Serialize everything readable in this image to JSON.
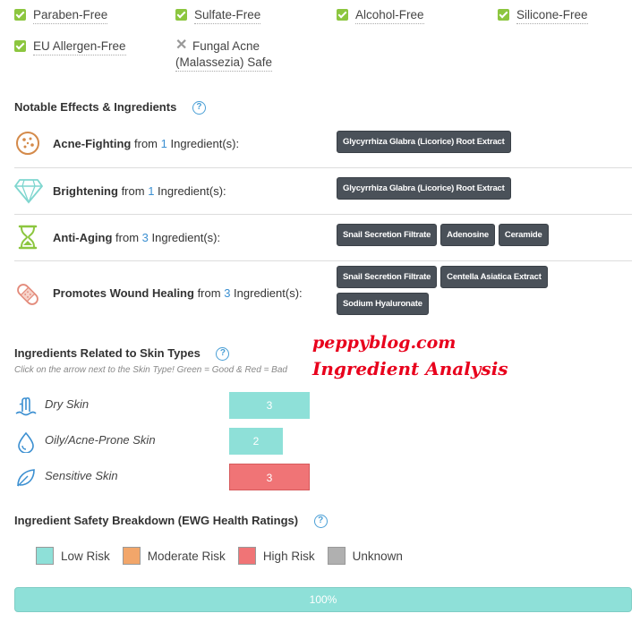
{
  "free_of": [
    {
      "label": "Paraben-Free",
      "status": "check"
    },
    {
      "label": "Sulfate-Free",
      "status": "check"
    },
    {
      "label": "Alcohol-Free",
      "status": "check"
    },
    {
      "label": "Silicone-Free",
      "status": "check"
    },
    {
      "label": "EU Allergen-Free",
      "status": "check"
    },
    {
      "label": "Fungal Acne",
      "label2": "(Malassezia) Safe",
      "status": "cross"
    }
  ],
  "notable": {
    "title": "Notable Effects & Ingredients",
    "help": "?",
    "from_text": "from",
    "suffix": "Ingredient(s):",
    "effects": [
      {
        "name": "Acne-Fighting",
        "count": "1",
        "icon": "acne-icon",
        "tags": [
          "Glycyrrhiza Glabra (Licorice) Root Extract"
        ]
      },
      {
        "name": "Brightening",
        "count": "1",
        "icon": "diamond-icon",
        "tags": [
          "Glycyrrhiza Glabra (Licorice) Root Extract"
        ]
      },
      {
        "name": "Anti-Aging",
        "count": "3",
        "icon": "hourglass-icon",
        "tags": [
          "Snail Secretion Filtrate",
          "Adenosine",
          "Ceramide"
        ]
      },
      {
        "name": "Promotes Wound Healing",
        "count": "3",
        "icon": "bandage-icon",
        "tags": [
          "Snail Secretion Filtrate",
          "Centella Asiatica Extract",
          "Sodium Hyaluronate"
        ]
      }
    ]
  },
  "skin_types": {
    "title": "Ingredients Related to Skin Types",
    "help": "?",
    "hint": "Click on the arrow next to the Skin Type! Green = Good & Red = Bad",
    "rows": [
      {
        "label": "Dry Skin",
        "value": "3",
        "icon": "dry-skin-icon",
        "color": "#8ee0d8"
      },
      {
        "label": "Oily/Acne-Prone Skin",
        "value": "2",
        "icon": "oily-skin-icon",
        "color": "#8ee0d8"
      },
      {
        "label": "Sensitive Skin",
        "value": "3",
        "icon": "sensitive-skin-icon",
        "color": "#f07476"
      }
    ]
  },
  "safety": {
    "title": "Ingredient Safety Breakdown (EWG Health Ratings)",
    "help": "?",
    "legend": [
      {
        "label": "Low Risk",
        "color": "#8ee0d8"
      },
      {
        "label": "Moderate Risk",
        "color": "#f2a66a"
      },
      {
        "label": "High Risk",
        "color": "#f07476"
      },
      {
        "label": "Unknown",
        "color": "#b0b0b0"
      }
    ],
    "bar_label": "100%",
    "low_risk_fraction": 1.0
  },
  "watermark": {
    "line1": "peppyblog.com",
    "line2": "Ingredient Analysis"
  },
  "colors": {
    "check_green": "#8cc63f",
    "accent_blue": "#3b8fd1",
    "tag_bg": "#4a5159"
  }
}
